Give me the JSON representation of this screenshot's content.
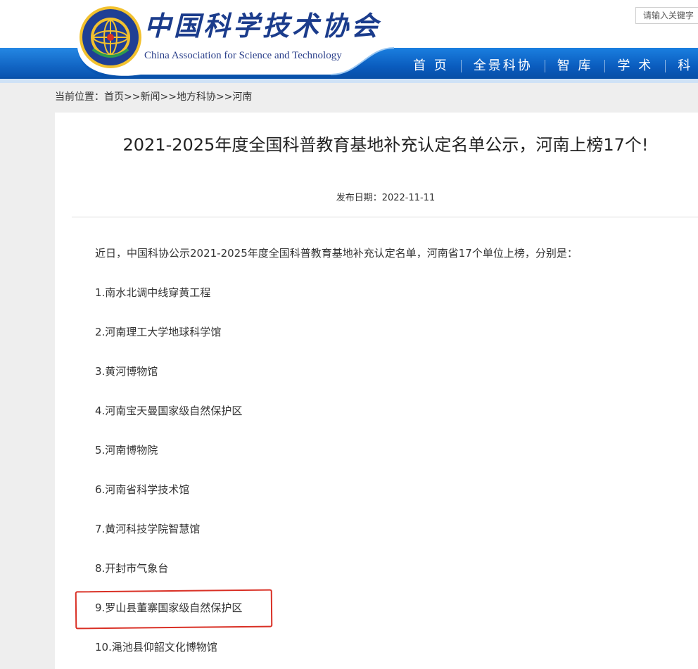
{
  "header": {
    "logo_cn": "中国科学技术协会",
    "logo_en": "China Association for Science and Technology",
    "search_placeholder": "请输入关键字",
    "nav": [
      "首 页",
      "全景科协",
      "智 库",
      "学 术",
      "科 普"
    ],
    "brand_blue": "#0a5bbd"
  },
  "breadcrumb": {
    "prefix": "当前位置：",
    "items": [
      "首页",
      "新闻",
      "地方科协",
      "河南"
    ],
    "separator": ">>"
  },
  "article": {
    "title": "2021-2025年度全国科普教育基地补充认定名单公示，河南上榜17个!",
    "date_label": "发布日期：",
    "date": "2022-11-11",
    "intro": "近日，中国科协公示2021-2025年度全国科普教育基地补充认定名单，河南省17个单位上榜，分别是：",
    "items": [
      "1.南水北调中线穿黄工程",
      "2.河南理工大学地球科学馆",
      "3.黄河博物馆",
      "4.河南宝天曼国家级自然保护区",
      "5.河南博物院",
      "6.河南省科学技术馆",
      "7.黄河科技学院智慧馆",
      "8.开封市气象台",
      "9.罗山县董寨国家级自然保护区",
      "10.渑池县仰韶文化博物馆"
    ],
    "highlight_color": "#d93025"
  }
}
